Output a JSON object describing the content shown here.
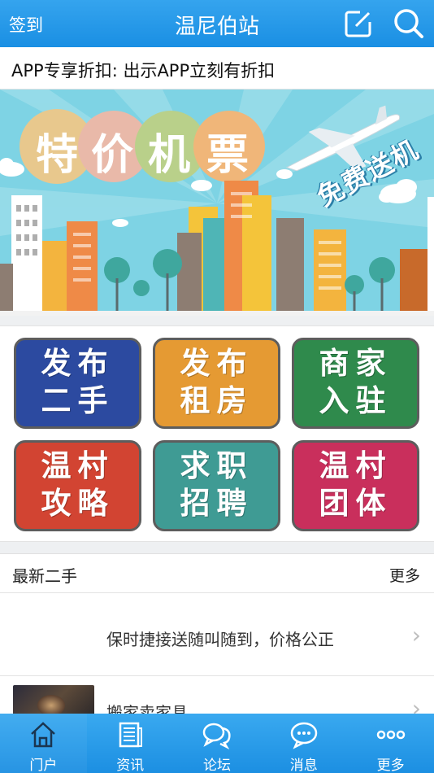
{
  "header": {
    "signin_label": "签到",
    "title": "温尼伯站",
    "edit_icon": "compose-icon",
    "search_icon": "search-icon"
  },
  "notice": {
    "text": "APP专享折扣: 出示APP立刻有折扣"
  },
  "banner": {
    "headline_chars": [
      "特",
      "价",
      "机",
      "票"
    ],
    "tagline": "免费送机",
    "slide_count": 7,
    "active_slide": 4
  },
  "tiles": [
    {
      "line1": "发布",
      "line2": "二手",
      "color": "#2c4aa0"
    },
    {
      "line1": "发布",
      "line2": "租房",
      "color": "#e59a33"
    },
    {
      "line1": "商家",
      "line2": "入驻",
      "color": "#2f8a4c"
    },
    {
      "line1": "温村",
      "line2": "攻略",
      "color": "#d24432"
    },
    {
      "line1": "求职",
      "line2": "招聘",
      "color": "#3f9b94"
    },
    {
      "line1": "温村",
      "line2": "团体",
      "color": "#c92f5c"
    }
  ],
  "section": {
    "title": "最新二手",
    "more": "更多",
    "items": [
      {
        "title": "保时捷接送随叫随到，价格公正"
      },
      {
        "title": "搬家卖家具"
      }
    ]
  },
  "tabbar": {
    "tabs": [
      {
        "label": "门户",
        "icon": "home-icon",
        "active": true
      },
      {
        "label": "资讯",
        "icon": "newspaper-icon",
        "active": false
      },
      {
        "label": "论坛",
        "icon": "chat-bubbles-icon",
        "active": false
      },
      {
        "label": "消息",
        "icon": "message-icon",
        "active": false
      },
      {
        "label": "更多",
        "icon": "more-dots-icon",
        "active": false
      }
    ]
  }
}
